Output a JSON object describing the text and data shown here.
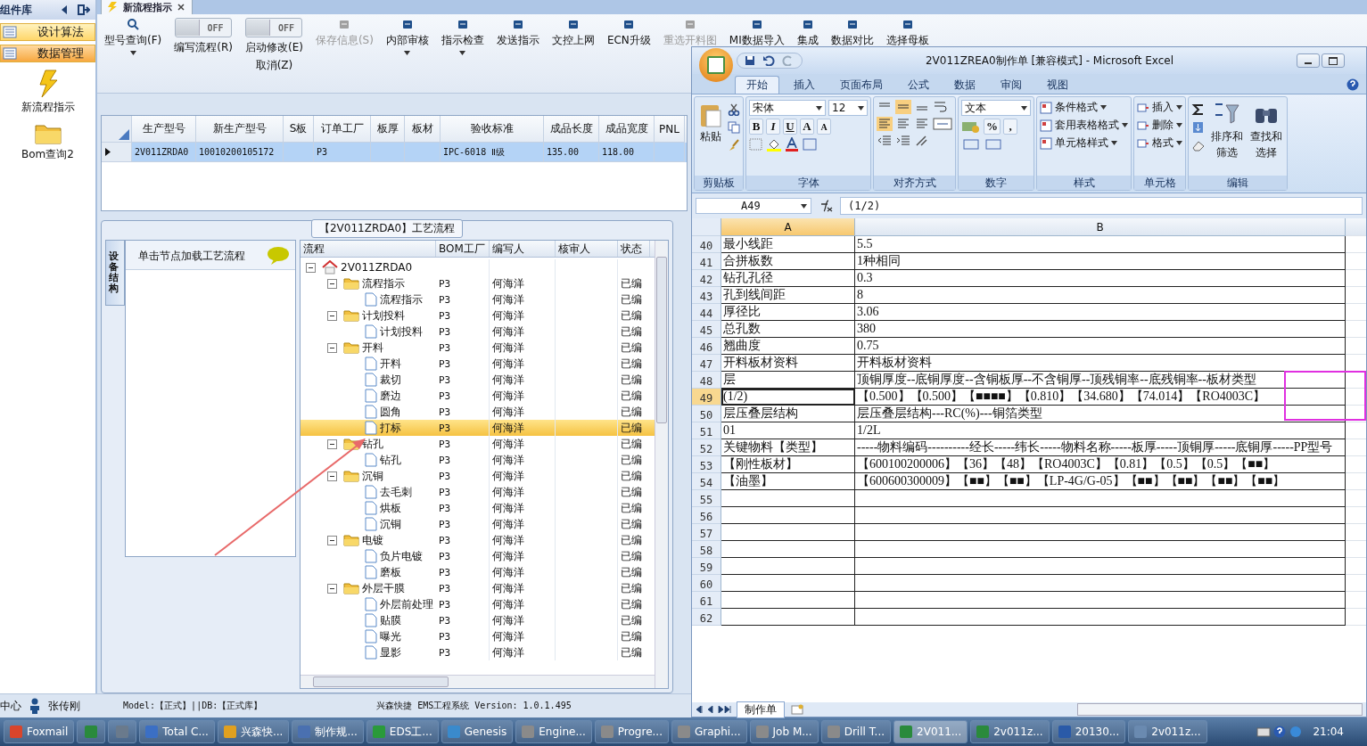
{
  "sidebar": {
    "title": "组件库",
    "items": [
      {
        "label": "设计算法",
        "selected": false
      },
      {
        "label": "数据管理",
        "selected": true
      }
    ],
    "shortcuts": [
      {
        "label": "新流程指示",
        "kind": "lightning"
      },
      {
        "label": "Bom查询2",
        "kind": "folder"
      }
    ]
  },
  "document_tab": {
    "label": "新流程指示"
  },
  "toolbar": [
    {
      "kind": "button",
      "label": "型号查询(F)",
      "dropdown": true,
      "disabled": false
    },
    {
      "kind": "toggle",
      "state": "OFF",
      "on": false,
      "label": "编写流程(R)"
    },
    {
      "kind": "toggle",
      "state": "OFF",
      "on": false,
      "label": "启动修改(E)",
      "sublabel": "取消(Z)"
    },
    {
      "kind": "button",
      "label": "保存信息(S)",
      "dropdown": false,
      "disabled": true
    },
    {
      "kind": "button",
      "label": "内部审核",
      "dropdown": true,
      "disabled": false
    },
    {
      "kind": "button",
      "label": "指示检查",
      "dropdown": true,
      "disabled": false
    },
    {
      "kind": "button",
      "label": "发送指示",
      "dropdown": false,
      "disabled": false
    },
    {
      "kind": "button",
      "label": "文控上网",
      "dropdown": false,
      "disabled": false
    },
    {
      "kind": "button",
      "label": "ECN升级",
      "dropdown": false,
      "disabled": false
    },
    {
      "kind": "button",
      "label": "重选开料图",
      "dropdown": false,
      "disabled": true
    },
    {
      "kind": "button",
      "label": "MI数据导入",
      "dropdown": false,
      "disabled": false
    },
    {
      "kind": "button",
      "label": "集成",
      "dropdown": false,
      "disabled": false
    },
    {
      "kind": "button",
      "label": "数据对比",
      "dropdown": false,
      "disabled": false
    },
    {
      "kind": "button",
      "label": "选择母板",
      "dropdown": false,
      "disabled": false
    }
  ],
  "grid": {
    "columns": [
      "生产型号",
      "新生产型号",
      "S板",
      "订单工厂",
      "板厚",
      "板材",
      "验收标准",
      "成品长度",
      "成品宽度",
      "PNL"
    ],
    "rows": [
      {
        "selected": true,
        "cells": [
          "2V011ZRDA0",
          "10010200105172",
          "",
          "P3",
          "",
          "",
          "IPC-6018 Ⅱ级",
          "135.00",
          "118.00",
          ""
        ]
      }
    ]
  },
  "process": {
    "title": "【2V011ZRDA0】工艺流程",
    "side_tab": "设备结构",
    "hint": "单击节点加载工艺流程",
    "columns": [
      "流程",
      "BOM工厂",
      "编写人",
      "核审人",
      "状态"
    ],
    "tree": {
      "label": "2V011ZRDA0",
      "kind": "root",
      "expanded": true,
      "selected": false,
      "children": [
        {
          "label": "流程指示",
          "kind": "folder",
          "bom": "P3",
          "writer": "何海洋",
          "status": "已编",
          "expanded": true,
          "selected": false,
          "children": [
            {
              "label": "流程指示",
              "kind": "file",
              "bom": "P3",
              "writer": "何海洋",
              "status": "已编",
              "selected": false
            }
          ]
        },
        {
          "label": "计划投料",
          "kind": "folder",
          "bom": "P3",
          "writer": "何海洋",
          "status": "已编",
          "expanded": true,
          "selected": false,
          "children": [
            {
              "label": "计划投料",
              "kind": "file",
              "bom": "P3",
              "writer": "何海洋",
              "status": "已编",
              "selected": false
            }
          ]
        },
        {
          "label": "开料",
          "kind": "folder",
          "bom": "P3",
          "writer": "何海洋",
          "status": "已编",
          "expanded": true,
          "selected": false,
          "children": [
            {
              "label": "开料",
              "kind": "file",
              "bom": "P3",
              "writer": "何海洋",
              "status": "已编",
              "selected": false
            },
            {
              "label": "裁切",
              "kind": "file",
              "bom": "P3",
              "writer": "何海洋",
              "status": "已编",
              "selected": false
            },
            {
              "label": "磨边",
              "kind": "file",
              "bom": "P3",
              "writer": "何海洋",
              "status": "已编",
              "selected": false
            },
            {
              "label": "圆角",
              "kind": "file",
              "bom": "P3",
              "writer": "何海洋",
              "status": "已编",
              "selected": false
            },
            {
              "label": "打标",
              "kind": "file",
              "bom": "P3",
              "writer": "何海洋",
              "status": "已编",
              "selected": true
            }
          ]
        },
        {
          "label": "钻孔",
          "kind": "folder",
          "bom": "P3",
          "writer": "何海洋",
          "status": "已编",
          "expanded": true,
          "selected": false,
          "children": [
            {
              "label": "钻孔",
              "kind": "file",
              "bom": "P3",
              "writer": "何海洋",
              "status": "已编",
              "selected": false
            }
          ]
        },
        {
          "label": "沉铜",
          "kind": "folder",
          "bom": "P3",
          "writer": "何海洋",
          "status": "已编",
          "expanded": true,
          "selected": false,
          "children": [
            {
              "label": "去毛刺",
              "kind": "file",
              "bom": "P3",
              "writer": "何海洋",
              "status": "已编",
              "selected": false
            },
            {
              "label": "烘板",
              "kind": "file",
              "bom": "P3",
              "writer": "何海洋",
              "status": "已编",
              "selected": false
            },
            {
              "label": "沉铜",
              "kind": "file",
              "bom": "P3",
              "writer": "何海洋",
              "status": "已编",
              "selected": false
            }
          ]
        },
        {
          "label": "电镀",
          "kind": "folder",
          "bom": "P3",
          "writer": "何海洋",
          "status": "已编",
          "expanded": true,
          "selected": false,
          "children": [
            {
              "label": "负片电镀",
              "kind": "file",
              "bom": "P3",
              "writer": "何海洋",
              "status": "已编",
              "selected": false
            },
            {
              "label": "磨板",
              "kind": "file",
              "bom": "P3",
              "writer": "何海洋",
              "status": "已编",
              "selected": false
            }
          ]
        },
        {
          "label": "外层干膜",
          "kind": "folder",
          "bom": "P3",
          "writer": "何海洋",
          "status": "已编",
          "expanded": true,
          "selected": false,
          "children": [
            {
              "label": "外层前处理",
              "kind": "file",
              "bom": "P3",
              "writer": "何海洋",
              "status": "已编",
              "selected": false
            },
            {
              "label": "贴膜",
              "kind": "file",
              "bom": "P3",
              "writer": "何海洋",
              "status": "已编",
              "selected": false
            },
            {
              "label": "曝光",
              "kind": "file",
              "bom": "P3",
              "writer": "何海洋",
              "status": "已编",
              "selected": false
            },
            {
              "label": "显影",
              "kind": "file",
              "bom": "P3",
              "writer": "何海洋",
              "status": "已编",
              "selected": false
            }
          ]
        }
      ]
    }
  },
  "status_bar": {
    "left": "中心",
    "user": "张传刚",
    "model": "Model:【正式】||DB:【正式库】",
    "app": "兴森快捷 EMS工程系统 Version: 1.0.1.495"
  },
  "excel": {
    "title": "2V011ZREA0制作单 [兼容模式] - Microsoft Excel",
    "tabs": [
      {
        "label": "开始",
        "selected": true
      },
      {
        "label": "插入",
        "selected": false
      },
      {
        "label": "页面布局",
        "selected": false
      },
      {
        "label": "公式",
        "selected": false
      },
      {
        "label": "数据",
        "selected": false
      },
      {
        "label": "审阅",
        "selected": false
      },
      {
        "label": "视图",
        "selected": false
      }
    ],
    "ribbon": {
      "paste": "粘贴",
      "font": "宋体",
      "size": "12",
      "font_buttons": [
        "B",
        "I",
        "U",
        "A",
        "A"
      ],
      "number_format": "文本",
      "number_buttons": [
        "%",
        ","
      ],
      "styles": [
        "条件格式",
        "套用表格格式",
        "单元格样式"
      ],
      "cells": [
        "插入",
        "删除",
        "格式"
      ],
      "sort": [
        "排序和",
        "筛选"
      ],
      "find": [
        "查找和",
        "选择"
      ],
      "groups": [
        "剪贴板",
        "字体",
        "对齐方式",
        "数字",
        "样式",
        "单元格",
        "编辑"
      ]
    },
    "name_box": "A49",
    "formula": "(1/2)",
    "columns": [
      {
        "label": "A",
        "selected": true
      },
      {
        "label": "B",
        "selected": false
      }
    ],
    "rows": [
      {
        "num": "40",
        "a": "最小线距",
        "b": "5.5",
        "selected": false
      },
      {
        "num": "41",
        "a": "合拼板数",
        "b": "1种相同",
        "selected": false
      },
      {
        "num": "42",
        "a": "钻孔孔径",
        "b": "0.3",
        "selected": false
      },
      {
        "num": "43",
        "a": "孔到线间距",
        "b": "8",
        "selected": false
      },
      {
        "num": "44",
        "a": "厚径比",
        "b": "3.06",
        "selected": false
      },
      {
        "num": "45",
        "a": "总孔数",
        "b": "380",
        "selected": false
      },
      {
        "num": "46",
        "a": "翘曲度",
        "b": "0.75",
        "selected": false
      },
      {
        "num": "47",
        "a": "开料板材资料",
        "b": "开料板材资料",
        "selected": false
      },
      {
        "num": "48",
        "a": "层",
        "b": "顶铜厚度--底铜厚度--含铜板厚--不含铜厚--顶残铜率--底残铜率--板材类型",
        "selected": false
      },
      {
        "num": "49",
        "a": "(1/2)",
        "b": "【0.500】【0.500】【■■■■】【0.810】【34.680】【74.014】【RO4003C】",
        "selected": true
      },
      {
        "num": "50",
        "a": "层压叠层结构",
        "b": "层压叠层结构---RC(%)---铜箔类型",
        "selected": false
      },
      {
        "num": "51",
        "a": "01",
        "b": "1/2L",
        "selected": false
      },
      {
        "num": "52",
        "a": "关键物料【类型】",
        "b": "-----物料编码----------经长-----纬长-----物料名称-----板厚-----顶铜厚-----底铜厚-----PP型号",
        "selected": false
      },
      {
        "num": "53",
        "a": "【刚性板材】",
        "b": "【600100200006】【36】【48】【RO4003C】【0.81】【0.5】【0.5】【■■】",
        "selected": false
      },
      {
        "num": "54",
        "a": "【油墨】",
        "b": "【600600300009】【■■】【■■】【LP-4G/G-05】【■■】【■■】【■■】【■■】",
        "selected": false
      },
      {
        "num": "55",
        "a": "",
        "b": "",
        "selected": false
      },
      {
        "num": "56",
        "a": "",
        "b": "",
        "selected": false
      },
      {
        "num": "57",
        "a": "",
        "b": "",
        "selected": false
      },
      {
        "num": "58",
        "a": "",
        "b": "",
        "selected": false
      },
      {
        "num": "59",
        "a": "",
        "b": "",
        "selected": false
      },
      {
        "num": "60",
        "a": "",
        "b": "",
        "selected": false
      },
      {
        "num": "61",
        "a": "",
        "b": "",
        "selected": false
      },
      {
        "num": "62",
        "a": "",
        "b": "",
        "selected": false
      }
    ],
    "sheet_tab": "制作单"
  },
  "taskbar": {
    "items": [
      {
        "label": "Foxmail",
        "selected": false
      },
      {
        "selected": false
      },
      {
        "selected": false
      },
      {
        "label": "Total C...",
        "selected": false
      },
      {
        "label": "兴森快...",
        "selected": false
      },
      {
        "label": "制作规...",
        "selected": false
      },
      {
        "label": "EDS工...",
        "selected": false
      },
      {
        "label": "Genesis",
        "selected": false
      },
      {
        "label": "Engine...",
        "selected": false
      },
      {
        "label": "Progre...",
        "selected": false
      },
      {
        "label": "Graphi...",
        "selected": false
      },
      {
        "label": "Job M...",
        "selected": false
      },
      {
        "label": "Drill T...",
        "selected": false
      },
      {
        "label": "2V011...",
        "selected": true
      },
      {
        "label": "2v011z...",
        "selected": false
      },
      {
        "label": "20130...",
        "selected": false
      },
      {
        "label": "2v011z...",
        "selected": false
      }
    ],
    "clock": "21:04"
  }
}
